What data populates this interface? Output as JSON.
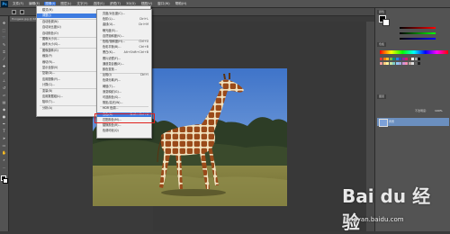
{
  "app": {
    "logo": "Ps"
  },
  "menubar": {
    "items": [
      "文件(F)",
      "编辑(E)",
      "图像(I)",
      "图层(L)",
      "文字(Y)",
      "选择(S)",
      "滤镜(T)",
      "3D(D)",
      "视图(V)",
      "窗口(W)",
      "帮助(H)"
    ]
  },
  "document": {
    "tab": "Hongwei.jpg @ 66.7%"
  },
  "image_menu": {
    "items": [
      {
        "label": "模式(M)",
        "shortcut": ""
      },
      {
        "label": "调整(J)",
        "shortcut": ""
      },
      {
        "label": "自动色调(N)",
        "shortcut": "Shift+Ctrl+L"
      },
      {
        "label": "自动对比度(U)",
        "shortcut": "Alt+Shift+Ctrl+L"
      },
      {
        "label": "自动颜色(O)",
        "shortcut": "Shift+Ctrl+B"
      },
      {
        "label": "图像大小(I)...",
        "shortcut": "Alt+Ctrl+I"
      },
      {
        "label": "画布大小(S)...",
        "shortcut": "Alt+Ctrl+C"
      },
      {
        "label": "图像旋转(G)",
        "shortcut": ""
      },
      {
        "label": "裁剪(P)",
        "shortcut": ""
      },
      {
        "label": "裁切(R)...",
        "shortcut": ""
      },
      {
        "label": "显示全部(V)",
        "shortcut": ""
      },
      {
        "label": "复制(D)...",
        "shortcut": ""
      },
      {
        "label": "应用图像(Y)...",
        "shortcut": ""
      },
      {
        "label": "计算(C)...",
        "shortcut": ""
      },
      {
        "label": "变量(B)",
        "shortcut": ""
      },
      {
        "label": "应用数据组(L)...",
        "shortcut": ""
      },
      {
        "label": "陷印(T)...",
        "shortcut": ""
      },
      {
        "label": "分析(A)",
        "shortcut": ""
      }
    ]
  },
  "adjust_menu": {
    "items": [
      {
        "label": "亮度/对比度(C)...",
        "shortcut": ""
      },
      {
        "label": "色阶(L)...",
        "shortcut": "Ctrl+L"
      },
      {
        "label": "曲线(U)...",
        "shortcut": "Ctrl+M"
      },
      {
        "label": "曝光度(E)...",
        "shortcut": ""
      },
      {
        "label": "自然饱和度(V)...",
        "shortcut": ""
      },
      {
        "label": "色相/饱和度(H)...",
        "shortcut": "Ctrl+U"
      },
      {
        "label": "色彩平衡(B)...",
        "shortcut": "Ctrl+B"
      },
      {
        "label": "黑白(K)...",
        "shortcut": "Alt+Shift+Ctrl+B"
      },
      {
        "label": "照片滤镜(F)...",
        "shortcut": ""
      },
      {
        "label": "通道混合器(X)...",
        "shortcut": ""
      },
      {
        "label": "颜色查找...",
        "shortcut": ""
      },
      {
        "label": "反相(I)",
        "shortcut": "Ctrl+I"
      },
      {
        "label": "色调分离(P)...",
        "shortcut": ""
      },
      {
        "label": "阈值(T)...",
        "shortcut": ""
      },
      {
        "label": "渐变映射(G)...",
        "shortcut": ""
      },
      {
        "label": "可选颜色(S)...",
        "shortcut": ""
      },
      {
        "label": "阴影/高光(W)...",
        "shortcut": ""
      },
      {
        "label": "HDR 色调...",
        "shortcut": ""
      },
      {
        "label": "去色(D)",
        "shortcut": "Shift+Ctrl+U"
      },
      {
        "label": "匹配颜色(M)...",
        "shortcut": ""
      },
      {
        "label": "替换颜色(R)...",
        "shortcut": ""
      },
      {
        "label": "色调均化(Q)",
        "shortcut": ""
      }
    ]
  },
  "panels": {
    "color_tab": "颜色",
    "swatch_tab": "色板",
    "layers_tab": "图层",
    "layer_name": "背景",
    "opacity_label": "不透明度:",
    "opacity_value": "100%"
  },
  "watermark": {
    "logo": "Bai du 经验",
    "url": "jingyan.baidu.com"
  }
}
